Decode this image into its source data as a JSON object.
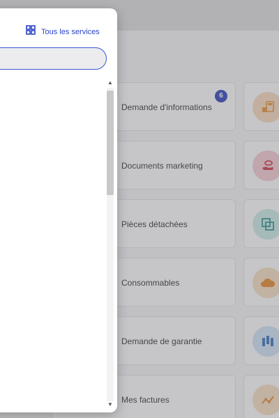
{
  "panel": {
    "all_services_label": "Tous les services",
    "search": {
      "value": "",
      "placeholder": ""
    }
  },
  "services": [
    {
      "label": "Demande d'informations",
      "badge": "6",
      "icon": "calculator-icon",
      "icon_bg": "#f8d8b8",
      "icon_color": "#e28a2c"
    },
    {
      "label": "Documents marketing",
      "badge": "",
      "icon": "hand-coin-icon",
      "icon_bg": "#f6c9d2",
      "icon_color": "#c72a3a"
    },
    {
      "label": "Pièces détachées",
      "badge": "",
      "icon": "parts-icon",
      "icon_bg": "#c9eae6",
      "icon_color": "#1e8c88"
    },
    {
      "label": "Consommables",
      "badge": "",
      "icon": "cloud-icon",
      "icon_bg": "#f8dcbc",
      "icon_color": "#e57e1c"
    },
    {
      "label": "Demande de garantie",
      "badge": "",
      "icon": "warranty-icon",
      "icon_bg": "#cfe2f6",
      "icon_color": "#2c6ab8"
    },
    {
      "label": "Mes factures",
      "badge": "",
      "icon": "invoice-chart-icon",
      "icon_bg": "#f8dcbc",
      "icon_color": "#e57e1c"
    }
  ],
  "colors": {
    "accent": "#2a42c8",
    "badge_bg": "#1f35b8"
  }
}
